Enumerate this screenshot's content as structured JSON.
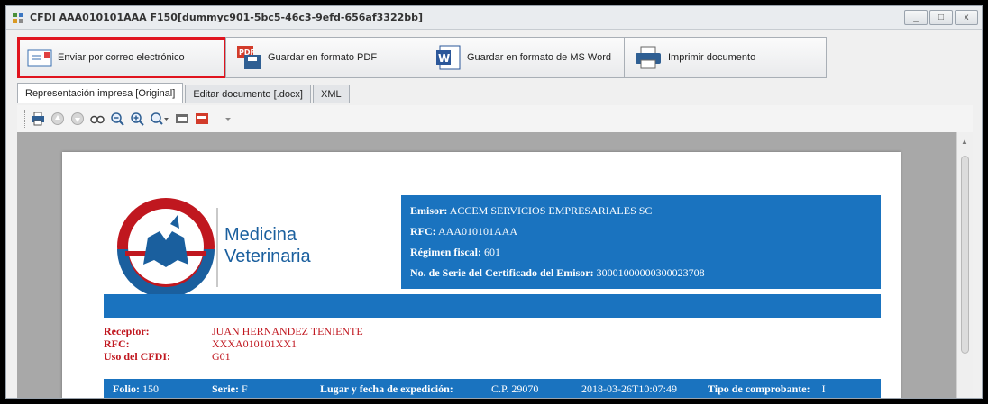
{
  "window": {
    "title": "CFDI AAA010101AAA F150[dummyc901-5bc5-46c3-9efd-656af3322bb]",
    "controls": {
      "minimize": "_",
      "maximize": "□",
      "close": "x"
    }
  },
  "actions": [
    {
      "label": "Enviar por correo electrónico",
      "icon": "email-icon"
    },
    {
      "label": "Guardar en formato PDF",
      "icon": "pdf-save-icon"
    },
    {
      "label": "Guardar en formato de MS Word",
      "icon": "word-icon"
    },
    {
      "label": "Imprimir documento",
      "icon": "printer-icon"
    }
  ],
  "tabs": [
    {
      "label": "Representación impresa [Original]",
      "active": true
    },
    {
      "label": "Editar documento [.docx]",
      "active": false
    },
    {
      "label": "XML",
      "active": false
    }
  ],
  "toolbar": {
    "icons": [
      "print-icon",
      "previous-page-icon",
      "next-page-icon",
      "find-icon",
      "zoom-out-icon",
      "zoom-in-icon",
      "zoom-dropdown-icon",
      "export-xml-icon",
      "export-pdf-icon",
      "more-icon"
    ]
  },
  "document": {
    "brand": {
      "line1": "Medicina",
      "line2": "Veterinaria"
    },
    "emisor": {
      "emisor_label": "Emisor:",
      "emisor_value": "ACCEM SERVICIOS EMPRESARIALES SC",
      "rfc_label": "RFC:",
      "rfc_value": "AAA010101AAA",
      "regimen_label": "Régimen fiscal:",
      "regimen_value": "601",
      "serie_cert_label": "No. de Serie del Certificado del Emisor:",
      "serie_cert_value": "30001000000300023708"
    },
    "receptor": {
      "receptor_label": "Receptor:",
      "receptor_value": "JUAN HERNANDEZ TENIENTE",
      "rfc_label": "RFC:",
      "rfc_value": "XXXA010101XX1",
      "uso_label": "Uso del CFDI:",
      "uso_value": "G01"
    },
    "folio_bar": {
      "folio_label": "Folio:",
      "folio_value": "150",
      "serie_label": "Serie:",
      "serie_value": "F",
      "lugar_label": "Lugar y fecha de expedición:",
      "cp_value": "C.P. 29070",
      "fecha_value": "2018-03-26T10:07:49",
      "tipo_label": "Tipo de comprobante:",
      "tipo_value": "I"
    }
  },
  "colors": {
    "accent_blue": "#1a73bf",
    "receptor_red": "#c0171f",
    "highlight_red": "#e0141e",
    "brand_blue": "#1a5f9e"
  }
}
